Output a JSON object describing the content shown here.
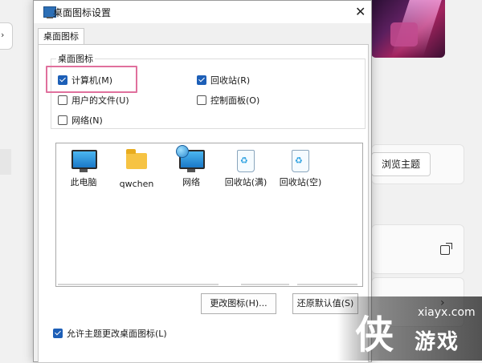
{
  "dialog": {
    "title": "桌面图标设置",
    "close_glyph": "✕",
    "tab_label": "桌面图标",
    "group_label": "桌面图标",
    "checkboxes": [
      {
        "label": "计算机(M)",
        "checked": true
      },
      {
        "label": "回收站(R)",
        "checked": true
      },
      {
        "label": "用户的文件(U)",
        "checked": false
      },
      {
        "label": "控制面板(O)",
        "checked": false
      },
      {
        "label": "网络(N)",
        "checked": false
      }
    ],
    "icons": [
      {
        "label": "此电脑",
        "icon": "this-pc-monitor-icon"
      },
      {
        "label": "qwchen",
        "icon": "user-folder-icon"
      },
      {
        "label": "网络",
        "icon": "network-monitor-icon"
      },
      {
        "label": "回收站(满)",
        "icon": "recycle-bin-full-icon"
      },
      {
        "label": "回收站(空)",
        "icon": "recycle-bin-empty-icon"
      }
    ],
    "buttons": {
      "change_icon": "更改图标(H)...",
      "restore_default": "还原默认值(S)"
    },
    "allow_themes": {
      "label": "允许主题更改桌面图标(L)",
      "checked": true
    },
    "highlight_color": "#e0709d"
  },
  "background": {
    "browse_themes": "浏览主题",
    "accent_color": "#1d5fb7"
  },
  "watermark": {
    "char": "侠",
    "domain": "xiayx.com",
    "name": "游戏"
  }
}
